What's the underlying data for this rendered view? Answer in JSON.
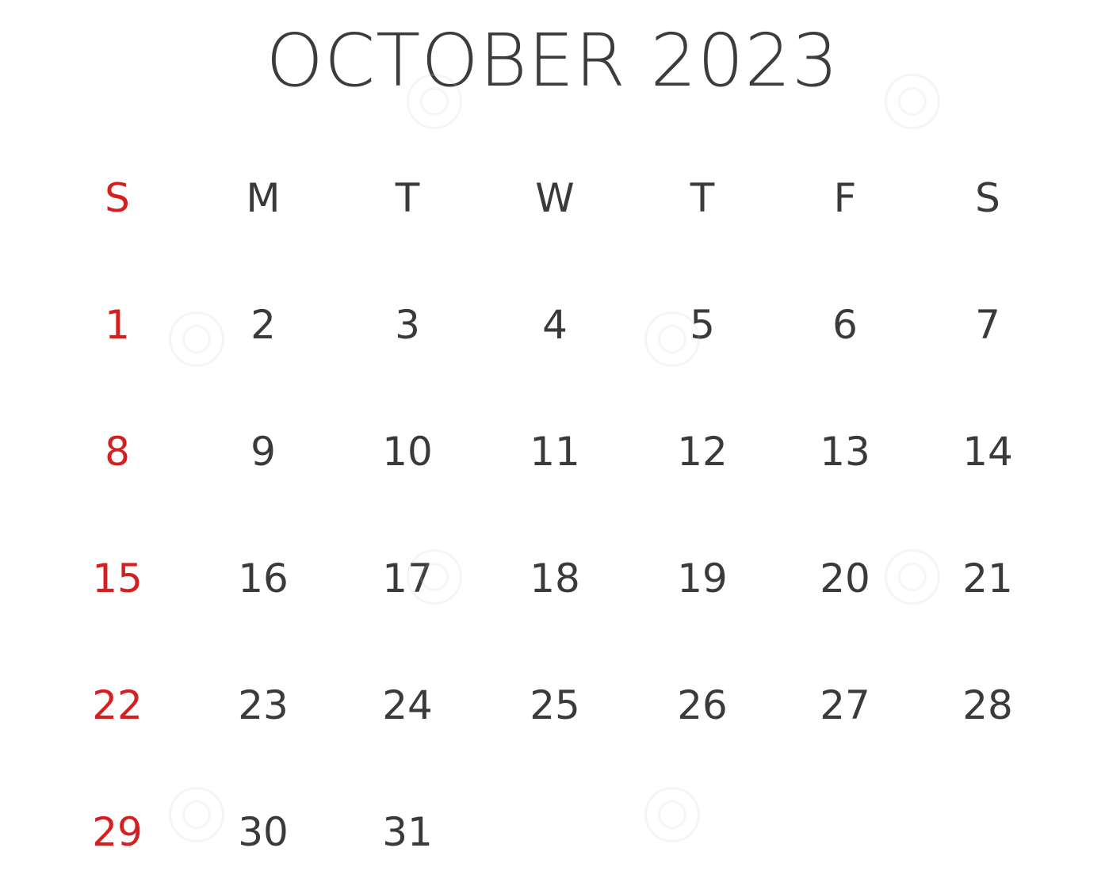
{
  "calendar": {
    "title": "OCTOBER 2023",
    "accent_color": "#d42020",
    "text_color": "#3a3a3a",
    "weekdays": [
      "S",
      "M",
      "T",
      "W",
      "T",
      "F",
      "S"
    ],
    "weeks": [
      [
        "1",
        "2",
        "3",
        "4",
        "5",
        "6",
        "7"
      ],
      [
        "8",
        "9",
        "10",
        "11",
        "12",
        "13",
        "14"
      ],
      [
        "15",
        "16",
        "17",
        "18",
        "19",
        "20",
        "21"
      ],
      [
        "22",
        "23",
        "24",
        "25",
        "26",
        "27",
        "28"
      ],
      [
        "29",
        "30",
        "31",
        "",
        "",
        "",
        ""
      ]
    ]
  }
}
